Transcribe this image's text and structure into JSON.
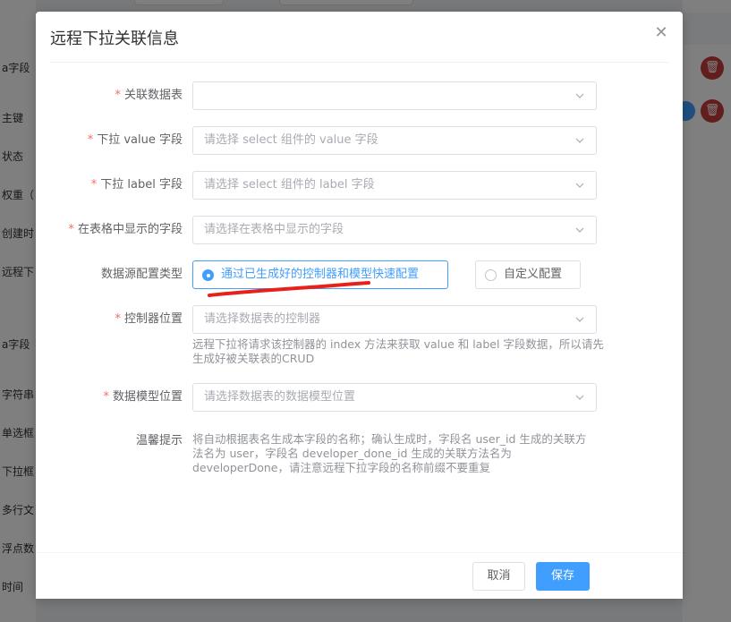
{
  "background": {
    "left_items": [
      "a字段",
      "主键",
      "状态",
      "权重（",
      "创建时",
      "远程下",
      "a字段",
      "字符串",
      "单选框",
      "下拉框",
      "多行文",
      "浮点数",
      "时间"
    ],
    "delete_icon": "trash-icon"
  },
  "dialog": {
    "title": "远程下拉关联信息",
    "close_icon": "close-icon",
    "fields": {
      "table": {
        "label": "关联数据表",
        "placeholder": ""
      },
      "value_field": {
        "label": "下拉 value 字段",
        "placeholder": "请选择 select 组件的 value 字段"
      },
      "label_field": {
        "label": "下拉 label 字段",
        "placeholder": "请选择 select 组件的 label 字段"
      },
      "display_field": {
        "label": "在表格中显示的字段",
        "placeholder": "请选择在表格中显示的字段"
      },
      "source_type": {
        "label": "数据源配置类型",
        "options": [
          "通过已生成好的控制器和模型快速配置",
          "自定义配置"
        ],
        "selected": "通过已生成好的控制器和模型快速配置"
      },
      "controller": {
        "label": "控制器位置",
        "placeholder": "请选择数据表的控制器",
        "help": "远程下拉将请求该控制器的 index 方法来获取 value 和 label 字段数据，所以请先生成好被关联表的CRUD"
      },
      "model": {
        "label": "数据模型位置",
        "placeholder": "请选择数据表的数据模型位置"
      },
      "tip": {
        "label": "温馨提示",
        "text": "将自动根据表名生成本字段的名称；确认生成时，字段名 user_id 生成的关联方法名为 user，字段名 developer_done_id 生成的关联方法名为 developerDone，请注意远程下拉字段的名称前缀不要重复"
      }
    },
    "footer": {
      "cancel": "取消",
      "save": "保存"
    }
  },
  "colors": {
    "primary": "#409eff",
    "required": "#f56c6c",
    "danger": "#c53b3b",
    "annotation": "#e8201a"
  }
}
